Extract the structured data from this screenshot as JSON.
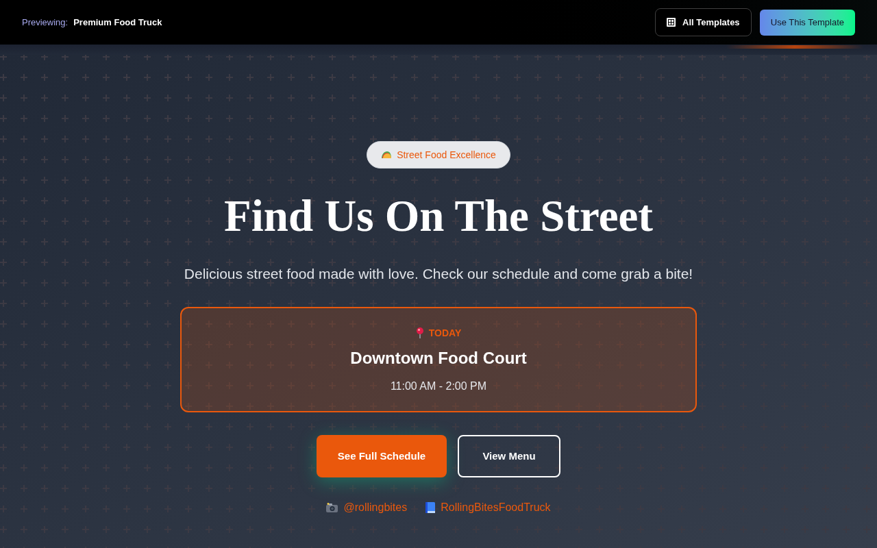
{
  "top_bar": {
    "label": "Previewing:",
    "template_name": "Premium Food Truck",
    "buttons": [
      {
        "label": "All Templates",
        "kind": "outline"
      },
      {
        "label": "Use This Template",
        "kind": "gradient"
      }
    ]
  },
  "hero": {
    "badge": "Street Food Excellence",
    "title": "Find Us On The Street",
    "subtitle": "Delicious street food made with love. Check our schedule and come grab a bite!",
    "today_card": {
      "label": "TODAY",
      "location": "Downtown Food Court",
      "hours": "11:00 AM - 2:00 PM"
    },
    "buttons": [
      {
        "label": "See Full Schedule",
        "kind": "primary"
      },
      {
        "label": "View Menu",
        "kind": "outline"
      }
    ],
    "social_links": [
      {
        "label": "@rollingbites",
        "kind": "camera"
      },
      {
        "label": "RollingBitesFoodTruck",
        "kind": "book"
      }
    ]
  }
}
